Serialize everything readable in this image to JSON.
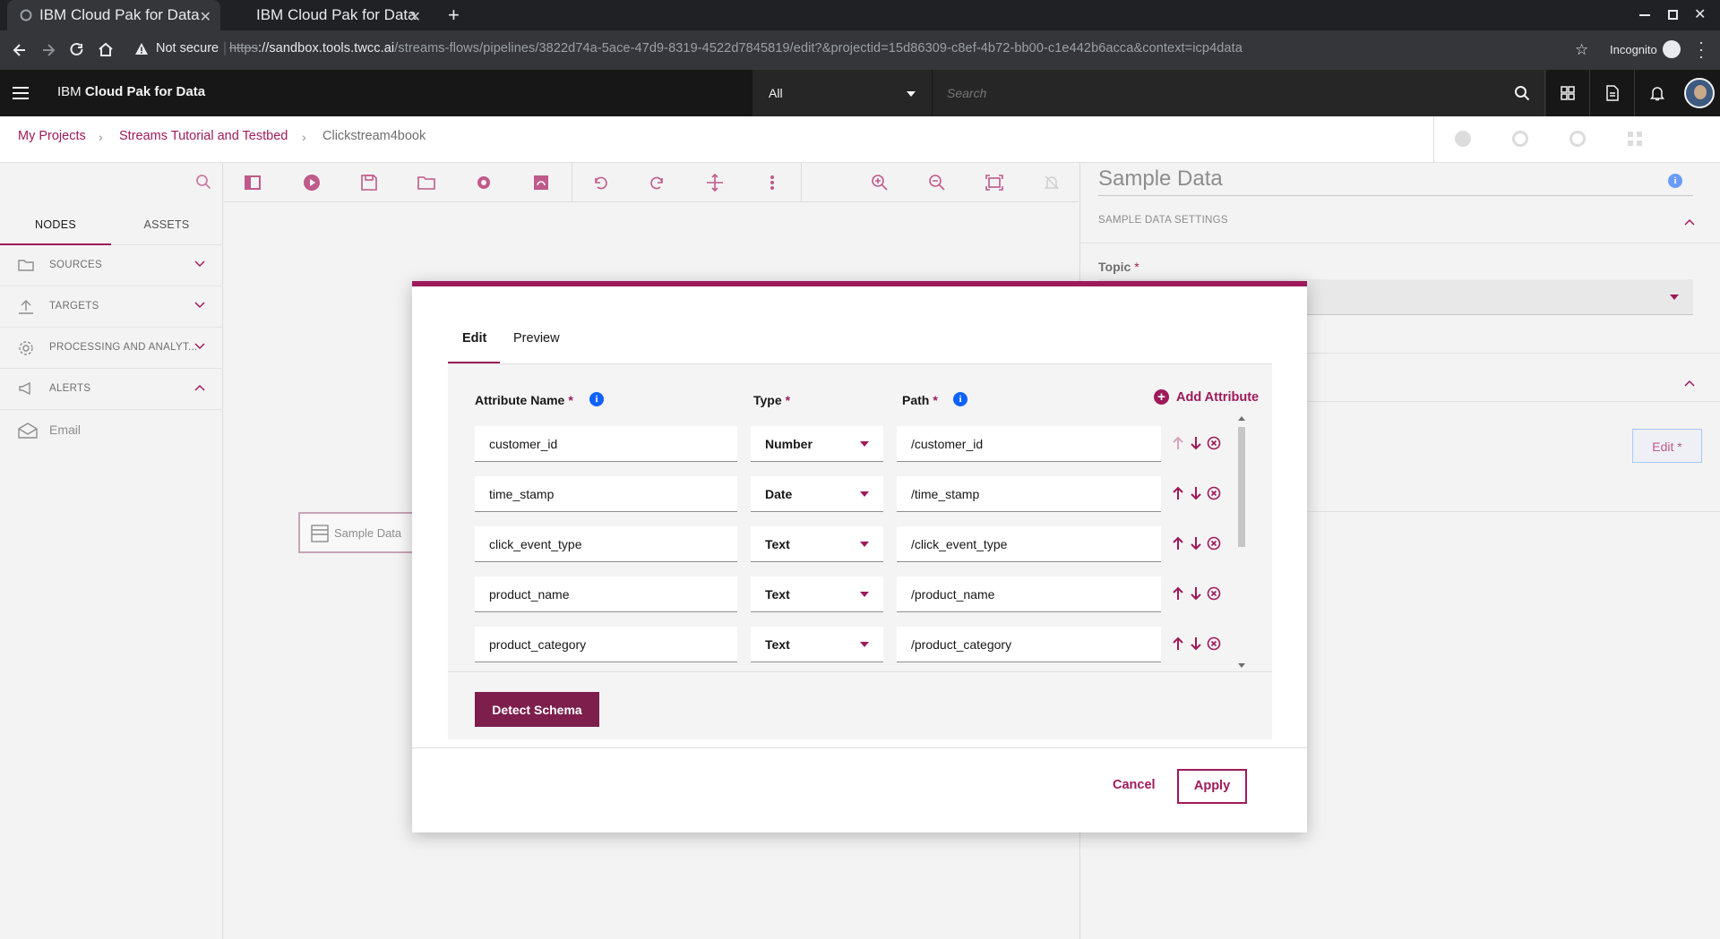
{
  "browser": {
    "tabs": [
      {
        "title": "IBM Cloud Pak for Data",
        "active": true
      },
      {
        "title": "IBM Cloud Pak for Data",
        "active": false
      }
    ],
    "new_tab": "+",
    "security_label": "Not secure",
    "url_scheme": "https",
    "url_host": "://sandbox.tools.twcc.ai",
    "url_path": "/streams-flows/pipelines/3822d74a-5ace-47d9-8319-4522d7845819/edit?&projectid=15d86309-c8ef-4b72-bb00-c1e442b6acca&context=icp4data",
    "incognito_label": "Incognito"
  },
  "app": {
    "brand_prefix": "IBM ",
    "brand_name": "Cloud Pak for Data",
    "scope_value": "All",
    "search_placeholder": "Search"
  },
  "breadcrumb": {
    "items": [
      "My Projects",
      "Streams Tutorial and Testbed",
      "Clickstream4book"
    ]
  },
  "palette": {
    "tabs": [
      "NODES",
      "ASSETS"
    ],
    "categories": [
      {
        "label": "SOURCES",
        "icon": "folder-icon",
        "expanded": false
      },
      {
        "label": "TARGETS",
        "icon": "upload-icon",
        "expanded": false
      },
      {
        "label": "PROCESSING AND ANALYT...",
        "icon": "gear-icon",
        "expanded": false
      },
      {
        "label": "ALERTS",
        "icon": "megaphone-icon",
        "expanded": true
      }
    ],
    "alert_items": [
      "Email"
    ]
  },
  "canvas": {
    "node_label": "Sample Data"
  },
  "right_panel": {
    "title": "Sample Data",
    "section": "SAMPLE DATA SETTINGS",
    "topic_label": "Topic",
    "required_mark": "*",
    "edit_button": "Edit *"
  },
  "modal": {
    "tabs": [
      "Edit",
      "Preview"
    ],
    "active_tab": "Edit",
    "columns": {
      "name": "Attribute Name",
      "type": "Type",
      "path": "Path",
      "required_mark": "*"
    },
    "add_attribute": "Add Attribute",
    "rows": [
      {
        "name": "customer_id",
        "type": "Number",
        "path": "/customer_id"
      },
      {
        "name": "time_stamp",
        "type": "Date",
        "path": "/time_stamp"
      },
      {
        "name": "click_event_type",
        "type": "Text",
        "path": "/click_event_type"
      },
      {
        "name": "product_name",
        "type": "Text",
        "path": "/product_name"
      },
      {
        "name": "product_category",
        "type": "Text",
        "path": "/product_category"
      }
    ],
    "detect_schema": "Detect Schema",
    "cancel": "Cancel",
    "apply": "Apply"
  },
  "colors": {
    "accent": "#9e1a5a",
    "info": "#0f62fe",
    "header_bg": "#171717"
  }
}
